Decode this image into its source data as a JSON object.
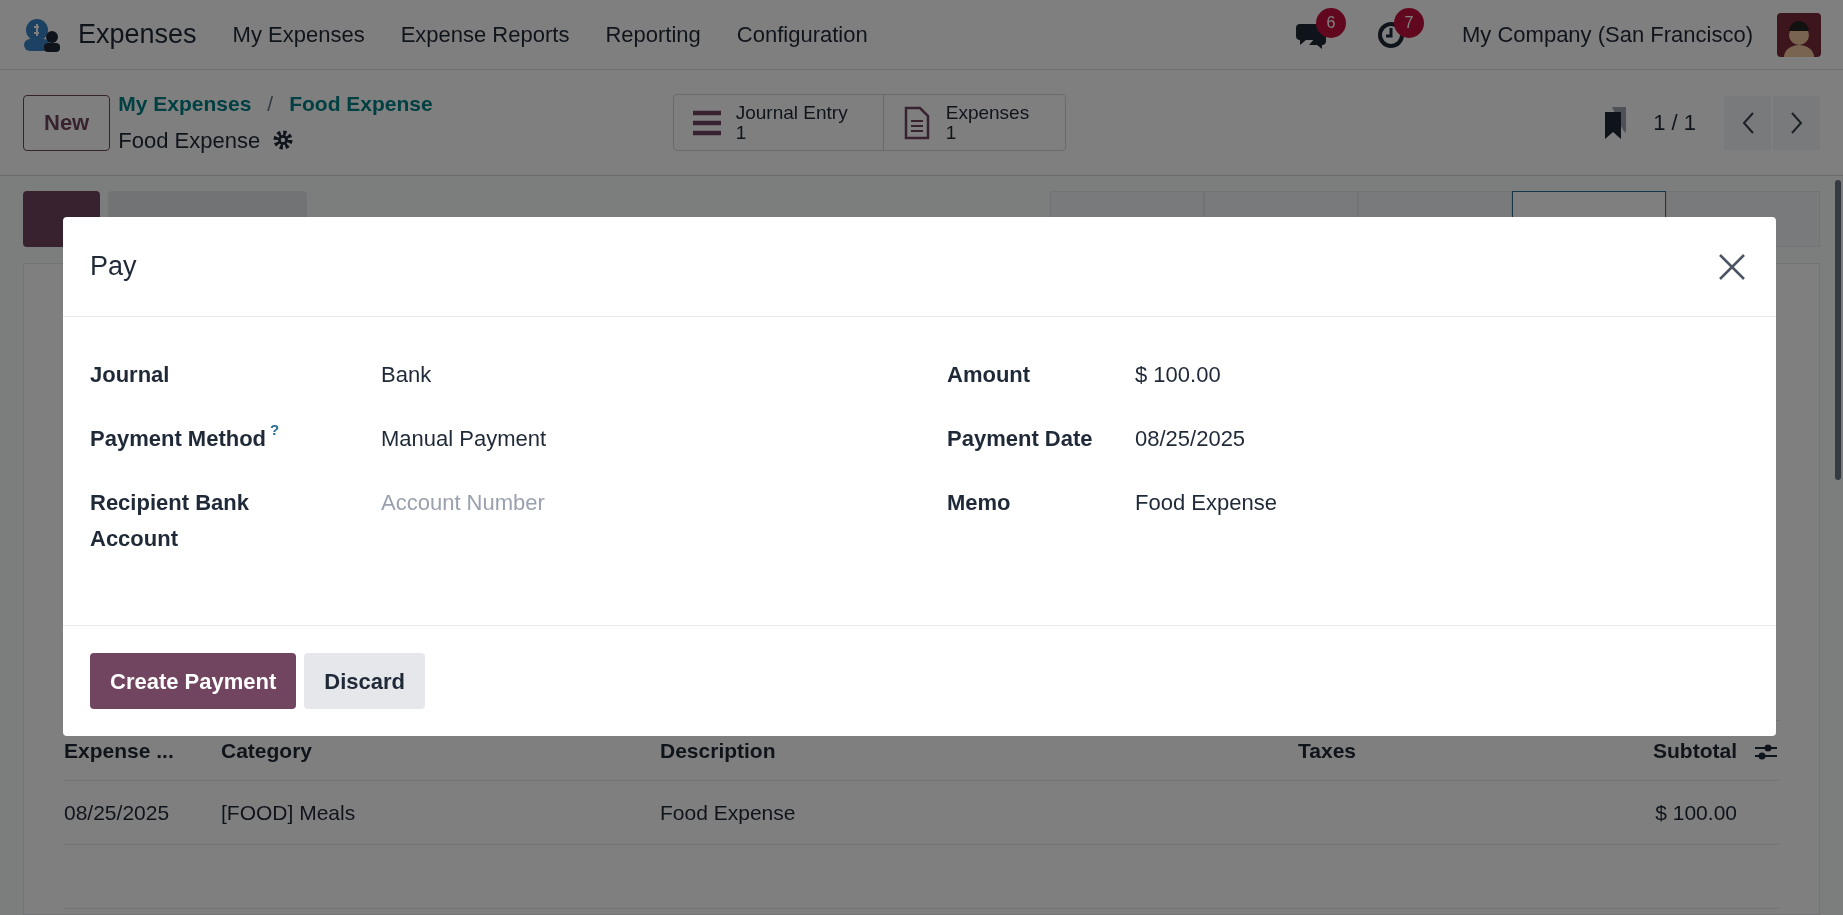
{
  "navbar": {
    "app_name": "Expenses",
    "menu": [
      "My Expenses",
      "Expense Reports",
      "Reporting",
      "Configuration"
    ],
    "messages_count": "6",
    "activities_count": "7",
    "company": "My Company (San Francisco)"
  },
  "control_panel": {
    "new_button": "New",
    "breadcrumbs": [
      "My Expenses",
      "Food Expense"
    ],
    "breadcrumb_separator": "/",
    "record_title": "Food Expense",
    "smart_buttons": [
      {
        "kind": "list",
        "label": "Journal Entry",
        "value": "1"
      },
      {
        "kind": "document",
        "label": "Expenses",
        "value": "1"
      }
    ],
    "pager": "1 / 1"
  },
  "actions": [
    {
      "kind": "primary"
    },
    {
      "kind": "secondary"
    }
  ],
  "statusbar": [
    {
      "selected": false
    },
    {
      "selected": false
    },
    {
      "selected": false
    },
    {
      "selected": true
    },
    {
      "selected": false
    }
  ],
  "dialog": {
    "title": "Pay",
    "left_fields": [
      {
        "label": "Journal",
        "value": "Bank"
      },
      {
        "label": "Payment Method",
        "help": "?",
        "value": "Manual Payment"
      },
      {
        "label": "Recipient Bank Account",
        "placeholder": "Account Number"
      }
    ],
    "right_fields": [
      {
        "label": "Amount",
        "value": "$ 100.00"
      },
      {
        "label": "Payment Date",
        "value": "08/25/2025"
      },
      {
        "label": "Memo",
        "value": "Food Expense"
      }
    ],
    "buttons": [
      {
        "label": "Create Payment",
        "kind": "primary"
      },
      {
        "label": "Discard",
        "kind": "secondary"
      }
    ]
  },
  "table": {
    "columns": [
      "Expense ...",
      "Category",
      "Description",
      "Taxes",
      "Subtotal"
    ],
    "rows": [
      [
        "08/25/2025",
        "[FOOD] Meals",
        "Food Expense",
        "",
        "$ 100.00"
      ]
    ]
  }
}
